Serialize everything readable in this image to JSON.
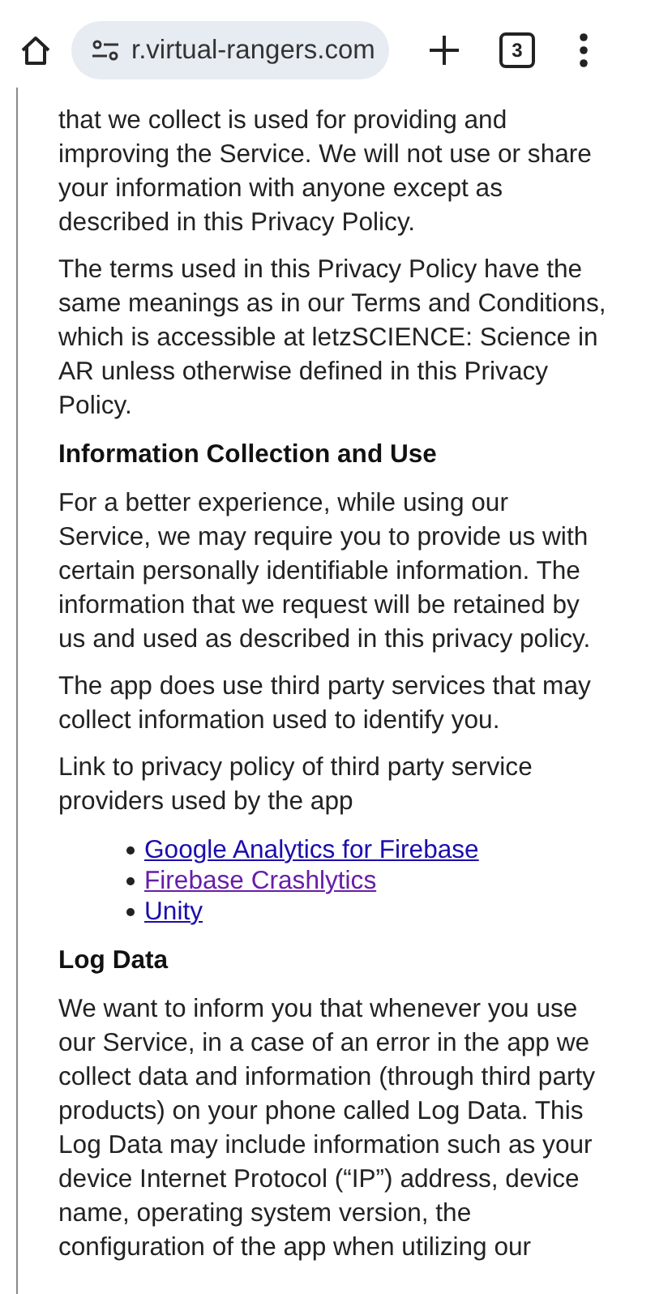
{
  "toolbar": {
    "url": "r.virtual-rangers.com",
    "tab_count": "3"
  },
  "content": [
    {
      "kind": "paragraph",
      "text": "that we collect is used for providing and improving the Service. We will not use or share your information with anyone except as described in this Privacy Policy."
    },
    {
      "kind": "paragraph",
      "text": "The terms used in this Privacy Policy have the same meanings as in our Terms and Conditions, which is accessible at letzSCIENCE: Science in AR unless otherwise defined in this Privacy Policy."
    },
    {
      "kind": "heading",
      "text": "Information Collection and Use"
    },
    {
      "kind": "paragraph",
      "text": "For a better experience, while using our Service, we may require you to provide us with certain personally identifiable information. The information that we request will be retained by us and used as described in this privacy policy."
    },
    {
      "kind": "paragraph",
      "text": "The app does use third party services that may collect information used to identify you."
    },
    {
      "kind": "paragraph",
      "text": "Link to privacy policy of third party service providers used by the app"
    },
    {
      "kind": "links",
      "items": [
        {
          "text": "Google Analytics for Firebase",
          "visited": false
        },
        {
          "text": "Firebase Crashlytics",
          "visited": true
        },
        {
          "text": "Unity",
          "visited": false
        }
      ]
    },
    {
      "kind": "heading",
      "text": "Log Data"
    },
    {
      "kind": "paragraph",
      "text": "We want to inform you that whenever you use our Service, in a case of an error in the app we collect data and information (through third party products) on your phone called Log Data. This Log Data may include information such as your device Internet Protocol (“IP”) address, device name, operating system version, the configuration of the app when utilizing our"
    }
  ]
}
